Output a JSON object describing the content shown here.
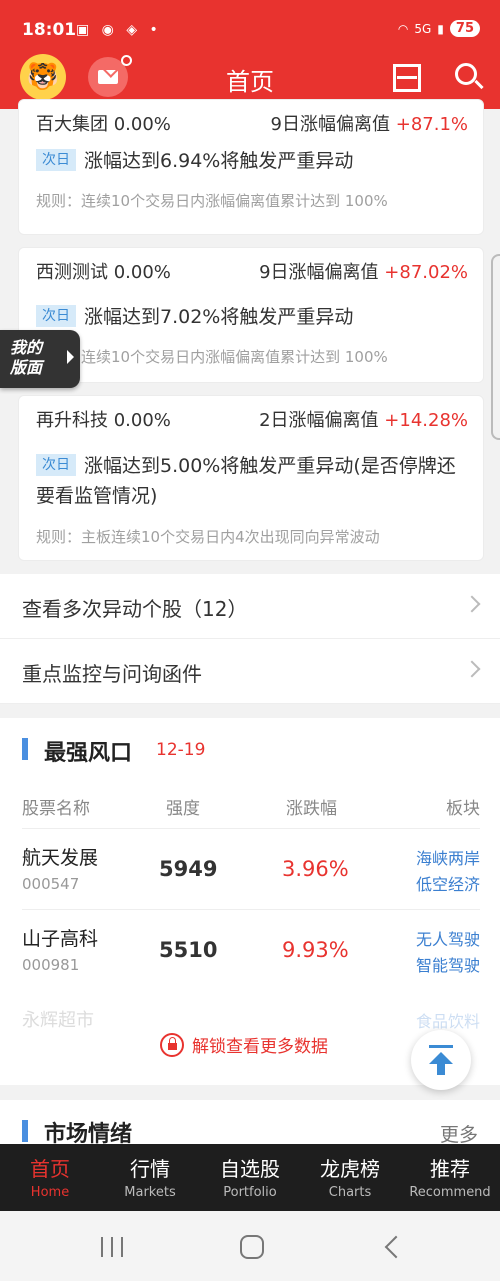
{
  "status": {
    "time": "18:01",
    "icons": "▣ ◉ ◈ •",
    "net": "5G",
    "battery": "75"
  },
  "header": {
    "title": "首页"
  },
  "alerts": [
    {
      "name": "百大集团 0.00%",
      "metric": "9日涨幅偏离值",
      "value": "+87.1%",
      "tag": "次日",
      "text": "涨幅达到6.94%将触发严重异动",
      "rule": "规则：连续10个交易日内涨幅偏离值累计达到 100%"
    },
    {
      "name": "西测测试 0.00%",
      "metric": "9日涨幅偏离值",
      "value": "+87.02%",
      "tag": "次日",
      "text": "涨幅达到7.02%将触发严重异动",
      "rule": "规则：连续10个交易日内涨幅偏离值累计达到 100%"
    },
    {
      "name": "再升科技 0.00%",
      "metric": "2日涨幅偏离值",
      "value": "+14.28%",
      "tag": "次日",
      "text": "涨幅达到5.00%将触发严重异动(是否停牌还要看监管情况)",
      "rule": "规则：主板连续10个交易日内4次出现同向异常波动"
    }
  ],
  "floating": {
    "my_layout": "我的\n版面"
  },
  "links": [
    {
      "label": "查看多次异动个股（12）"
    },
    {
      "label": "重点监控与问询函件"
    }
  ],
  "strongest": {
    "title": "最强风口",
    "date": "12-19",
    "headers": [
      "股票名称",
      "强度",
      "涨跌幅",
      "板块"
    ],
    "rows": [
      {
        "name": "航天发展",
        "code": "000547",
        "strength": "5949",
        "change": "3.96%",
        "sector1": "海峡两岸",
        "sector2": "低空经济"
      },
      {
        "name": "山子高科",
        "code": "000981",
        "strength": "5510",
        "change": "9.93%",
        "sector1": "无人驾驶",
        "sector2": "智能驾驶"
      }
    ],
    "faded_name": "永辉超市",
    "faded_sector": "食品饮料",
    "unlock": "解锁查看更多数据"
  },
  "mood": {
    "title": "市场情绪",
    "more": "更多"
  },
  "tabs": [
    {
      "zh": "首页",
      "en": "Home"
    },
    {
      "zh": "行情",
      "en": "Markets"
    },
    {
      "zh": "自选股",
      "en": "Portfolio"
    },
    {
      "zh": "龙虎榜",
      "en": "Charts"
    },
    {
      "zh": "推荐",
      "en": "Recommend"
    }
  ]
}
